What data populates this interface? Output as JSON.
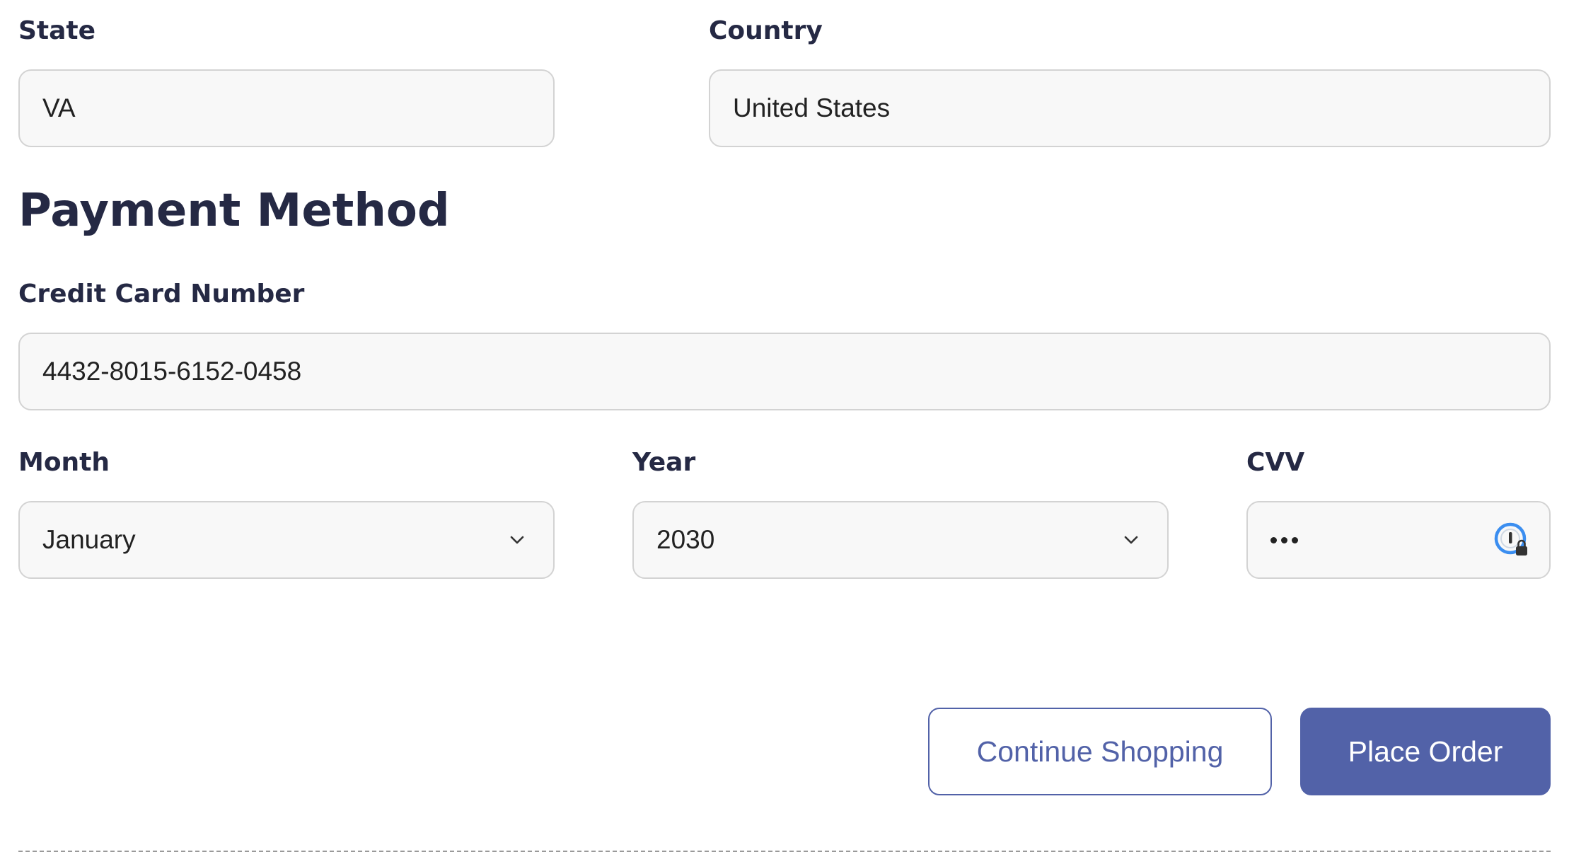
{
  "address": {
    "state": {
      "label": "State",
      "value": "VA"
    },
    "country": {
      "label": "Country",
      "value": "United States"
    }
  },
  "payment": {
    "heading": "Payment Method",
    "card_number": {
      "label": "Credit Card Number",
      "value": "4432-8015-6152-0458"
    },
    "month": {
      "label": "Month",
      "value": "January"
    },
    "year": {
      "label": "Year",
      "value": "2030"
    },
    "cvv": {
      "label": "CVV",
      "masked_length": 3,
      "icon": "password-manager-icon"
    }
  },
  "actions": {
    "continue_label": "Continue Shopping",
    "place_order_label": "Place Order"
  },
  "colors": {
    "text": "#252944",
    "accent": "#5262a8",
    "field_bg": "#f8f8f8",
    "field_border": "#d3d3d3",
    "pm_blue": "#3b8ef0"
  }
}
